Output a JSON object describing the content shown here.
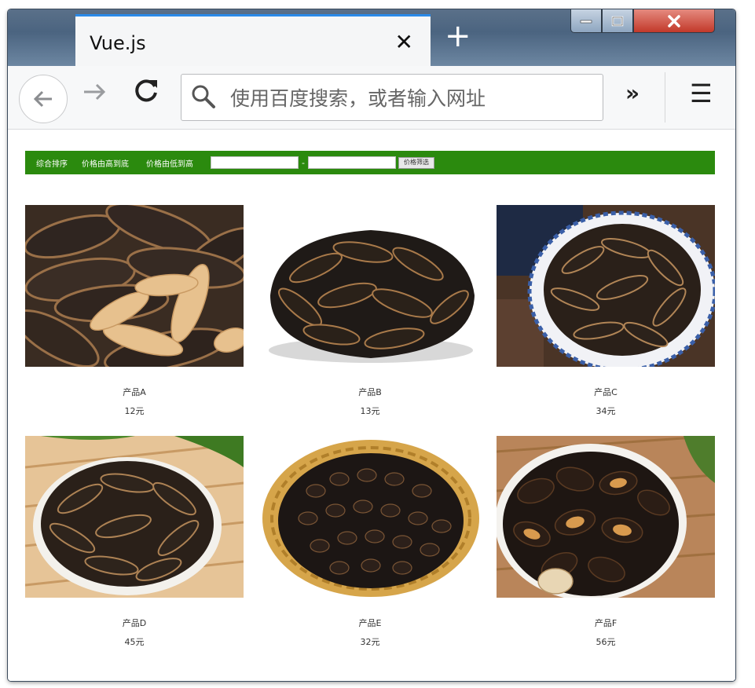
{
  "browser": {
    "tab_title": "Vue.js",
    "tab_close": "✕",
    "new_tab": "+",
    "search_placeholder": "使用百度搜索，或者输入网址",
    "overflow_label": "»",
    "menu_label": "☰"
  },
  "filters": {
    "sort_default": "综合排序",
    "sort_high_low": "价格由高到底",
    "sort_low_high": "价格由低到高",
    "range_dash": "-",
    "filter_button": "价格筛选"
  },
  "products": [
    {
      "name": "产品A",
      "price": "12元"
    },
    {
      "name": "产品B",
      "price": "13元"
    },
    {
      "name": "产品C",
      "price": "34元"
    },
    {
      "name": "产品D",
      "price": "45元"
    },
    {
      "name": "产品E",
      "price": "32元"
    },
    {
      "name": "产品F",
      "price": "56元"
    }
  ],
  "colors": {
    "filter_bar": "#2b8a0e",
    "tab_accent": "#2a8ae8"
  }
}
